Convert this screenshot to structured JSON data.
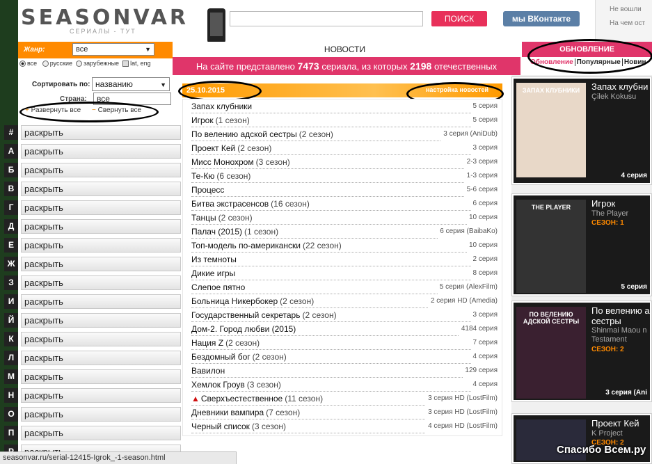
{
  "header": {
    "logo_text": "SEASONVAR",
    "logo_sub": "СЕРИАЛЫ - ТУТ",
    "search_placeholder": "",
    "search_button": "ПОИСК",
    "vk_button": "мы ВКонтакте",
    "top_right": [
      "Не вошли",
      "На чем ост"
    ]
  },
  "filters": {
    "genre_label": "Жанр:",
    "genre_value": "все",
    "options": [
      "все",
      "русские",
      "зарубежные",
      "lat, eng"
    ],
    "sort_label": "Сортировать по:",
    "sort_value": "названию",
    "sort2_label": "Страна:",
    "sort2_value": "все",
    "expand_all": "Развернуть все",
    "collapse_all": "Свернуть все"
  },
  "letters": [
    {
      "letter": "#",
      "label": "раскрыть"
    },
    {
      "letter": "А",
      "label": "раскрыть"
    },
    {
      "letter": "Б",
      "label": "раскрыть"
    },
    {
      "letter": "В",
      "label": "раскрыть"
    },
    {
      "letter": "Г",
      "label": "раскрыть"
    },
    {
      "letter": "Д",
      "label": "раскрыть"
    },
    {
      "letter": "Е",
      "label": "раскрыть"
    },
    {
      "letter": "Ж",
      "label": "раскрыть"
    },
    {
      "letter": "З",
      "label": "раскрыть"
    },
    {
      "letter": "И",
      "label": "раскрыть"
    },
    {
      "letter": "Й",
      "label": "раскрыть"
    },
    {
      "letter": "К",
      "label": "раскрыть"
    },
    {
      "letter": "Л",
      "label": "раскрыть"
    },
    {
      "letter": "М",
      "label": "раскрыть"
    },
    {
      "letter": "Н",
      "label": "раскрыть"
    },
    {
      "letter": "О",
      "label": "раскрыть"
    },
    {
      "letter": "П",
      "label": "раскрыть"
    },
    {
      "letter": "Р",
      "label": "раскрыть"
    }
  ],
  "news": {
    "tab_label": "НОВОСТИ",
    "stats_prefix": "На сайте представлено",
    "stats_total": "7473",
    "stats_mid": "сериала, из которых",
    "stats_count": "2198",
    "stats_suffix": "отечественных",
    "date": "25.10.2015",
    "settings_label": "настройка новостей",
    "items": [
      {
        "title": "Запах клубники",
        "season": "",
        "episode": "5 серия"
      },
      {
        "title": "Игрок",
        "season": "(1 сезон)",
        "episode": "5 серия"
      },
      {
        "title": "По велению адской сестры",
        "season": "(2 сезон)",
        "episode": "3 серия (AniDub)"
      },
      {
        "title": "Проект Кей",
        "season": "(2 сезон)",
        "episode": "3 серия"
      },
      {
        "title": "Мисс Монохром",
        "season": "(3 сезон)",
        "episode": "2-3 серия"
      },
      {
        "title": "Те-Кю",
        "season": "(6 сезон)",
        "episode": "1-3 серия"
      },
      {
        "title": "Процесс",
        "season": "",
        "episode": "5-6 серия"
      },
      {
        "title": "Битва экстрасенсов",
        "season": "(16 сезон)",
        "episode": "6 серия"
      },
      {
        "title": "Танцы",
        "season": "(2 сезон)",
        "episode": "10 серия"
      },
      {
        "title": "Палач (2015)",
        "season": "(1 сезон)",
        "episode": "6 серия (BaibaKo)"
      },
      {
        "title": "Топ-модель по-американски",
        "season": "(22 сезон)",
        "episode": "10 серия"
      },
      {
        "title": "Из темноты",
        "season": "",
        "episode": "2 серия"
      },
      {
        "title": "Дикие игры",
        "season": "",
        "episode": "8 серия"
      },
      {
        "title": "Слепое пятно",
        "season": "",
        "episode": "5 серия (AlexFilm)"
      },
      {
        "title": "Больница Никербокер",
        "season": "(2 сезон)",
        "episode": "2 серия HD (Amedia)"
      },
      {
        "title": "Государственный секретарь",
        "season": "(2 сезон)",
        "episode": "3 серия"
      },
      {
        "title": "Дом-2. Город любви (2015)",
        "season": "",
        "episode": "4184 серия"
      },
      {
        "title": "Нация Z",
        "season": "(2 сезон)",
        "episode": "7 серия"
      },
      {
        "title": "Бездомный бог",
        "season": "(2 сезон)",
        "episode": "4 серия"
      },
      {
        "title": "Вавилон",
        "season": "",
        "episode": "129 серия"
      },
      {
        "title": "Хемлок Гроув",
        "season": "(3 сезон)",
        "episode": "4 серия"
      },
      {
        "title": "Сверхъестественное",
        "season": "(11 сезон)",
        "episode": "3 серия HD (LostFilm)",
        "warning": true
      },
      {
        "title": "Дневники вампира",
        "season": "(7 сезон)",
        "episode": "3 серия HD (LostFilm)"
      },
      {
        "title": "Черный список",
        "season": "(3 сезон)",
        "episode": "4 серия HD (LostFilm)"
      }
    ]
  },
  "updates": {
    "header": "ОБНОВЛЕНИЕ",
    "tabs": [
      "Обновление",
      "Популярные",
      "Новин"
    ],
    "cards": [
      {
        "title": "Запах клубни",
        "orig": "Çilek Kokusu",
        "season": "",
        "episode": "4 серия",
        "poster_text": "ЗАПАХ КЛУБНИКИ",
        "poster_bg": "#e8d8c8"
      },
      {
        "title": "Игрок",
        "orig": "The Player",
        "season": "СЕЗОН: 1",
        "episode": "5 серия",
        "poster_text": "THE PLAYER",
        "poster_bg": "#333333"
      },
      {
        "title": "По велению а сестры",
        "orig": "Shinmai Maou n Testament",
        "season": "СЕЗОН: 2",
        "episode": "3 серия (Ani",
        "poster_text": "ПО ВЕЛЕНИЮ АДСКОЙ СЕСТРЫ",
        "poster_bg": "#3a2030"
      },
      {
        "title": "Проект Кей",
        "orig": "K Project",
        "season": "СЕЗОН: 2",
        "episode": "",
        "poster_text": "",
        "poster_bg": "#2a2a3a"
      }
    ]
  },
  "status_bar": "seasonvar.ru/serial-12415-Igrok_-1-season.html",
  "watermark": "Спасибо Всем.ру",
  "colors": {
    "accent_pink": "#e0356a",
    "accent_orange": "#ff8a00",
    "search_btn": "#e8305a",
    "vk_btn": "#5b7fa6"
  }
}
